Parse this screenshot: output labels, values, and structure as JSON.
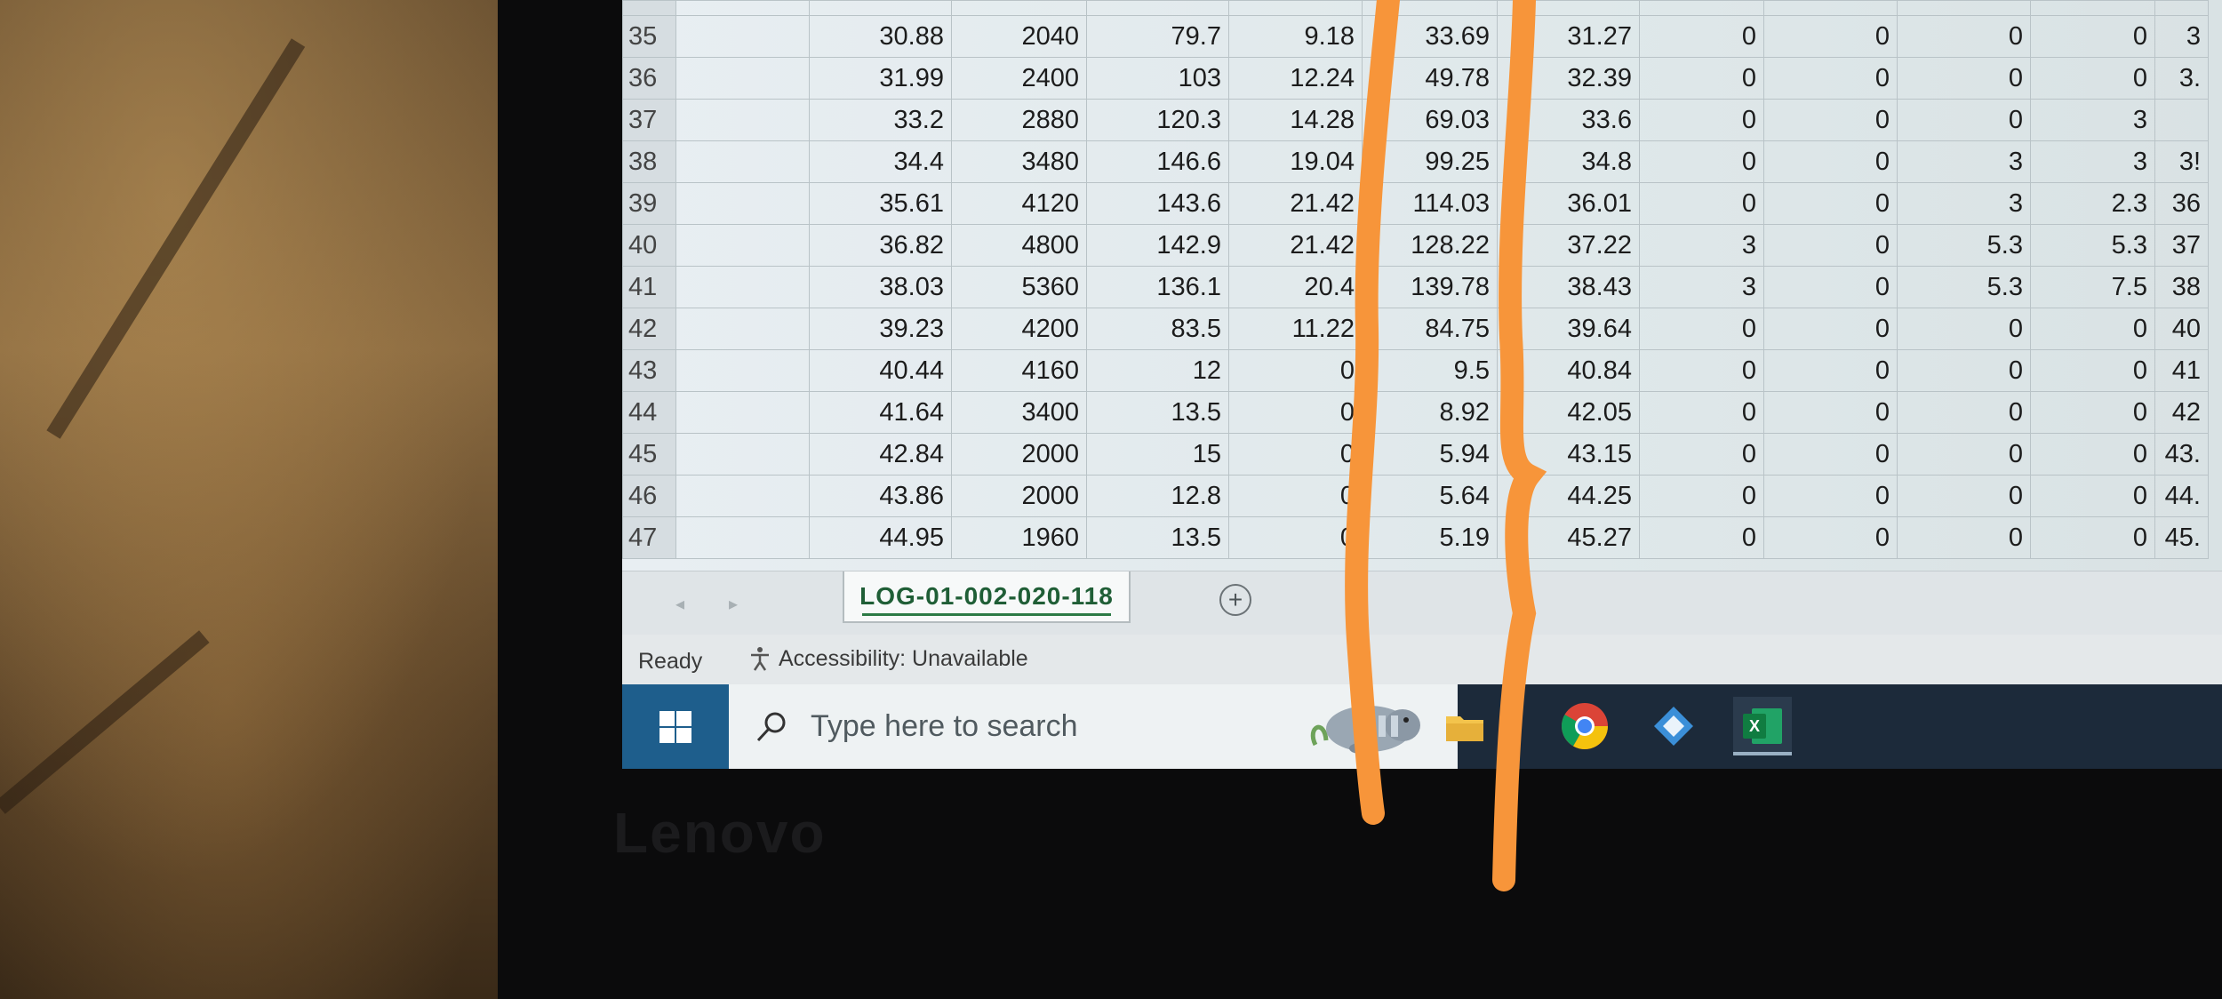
{
  "sheet": {
    "rows": [
      {
        "num": "35",
        "cells": [
          "30.88",
          "2040",
          "79.7",
          "9.18",
          "33.69",
          "31.27",
          "0",
          "0",
          "0",
          "0",
          "3"
        ]
      },
      {
        "num": "36",
        "cells": [
          "31.99",
          "2400",
          "103",
          "12.24",
          "49.78",
          "32.39",
          "0",
          "0",
          "0",
          "0",
          "3."
        ]
      },
      {
        "num": "37",
        "cells": [
          "33.2",
          "2880",
          "120.3",
          "14.28",
          "69.03",
          "33.6",
          "0",
          "0",
          "0",
          "3",
          ""
        ]
      },
      {
        "num": "38",
        "cells": [
          "34.4",
          "3480",
          "146.6",
          "19.04",
          "99.25",
          "34.8",
          "0",
          "0",
          "3",
          "3",
          "3!"
        ]
      },
      {
        "num": "39",
        "cells": [
          "35.61",
          "4120",
          "143.6",
          "21.42",
          "114.03",
          "36.01",
          "0",
          "0",
          "3",
          "2.3",
          "36"
        ]
      },
      {
        "num": "40",
        "cells": [
          "36.82",
          "4800",
          "142.9",
          "21.42",
          "128.22",
          "37.22",
          "3",
          "0",
          "5.3",
          "5.3",
          "37"
        ]
      },
      {
        "num": "41",
        "cells": [
          "38.03",
          "5360",
          "136.1",
          "20.4",
          "139.78",
          "38.43",
          "3",
          "0",
          "5.3",
          "7.5",
          "38"
        ]
      },
      {
        "num": "42",
        "cells": [
          "39.23",
          "4200",
          "83.5",
          "11.22",
          "84.75",
          "39.64",
          "0",
          "0",
          "0",
          "0",
          "40"
        ]
      },
      {
        "num": "43",
        "cells": [
          "40.44",
          "4160",
          "12",
          "0",
          "9.5",
          "40.84",
          "0",
          "0",
          "0",
          "0",
          "41"
        ]
      },
      {
        "num": "44",
        "cells": [
          "41.64",
          "3400",
          "13.5",
          "0",
          "8.92",
          "42.05",
          "0",
          "0",
          "0",
          "0",
          "42"
        ]
      },
      {
        "num": "45",
        "cells": [
          "42.84",
          "2000",
          "15",
          "0",
          "5.94",
          "43.15",
          "0",
          "0",
          "0",
          "0",
          "43."
        ]
      },
      {
        "num": "46",
        "cells": [
          "43.86",
          "2000",
          "12.8",
          "0",
          "5.64",
          "44.25",
          "0",
          "0",
          "0",
          "0",
          "44."
        ]
      },
      {
        "num": "47",
        "cells": [
          "44.95",
          "1960",
          "13.5",
          "0",
          "5.19",
          "45.27",
          "0",
          "0",
          "0",
          "0",
          "45."
        ]
      }
    ]
  },
  "tabs": {
    "active": "LOG-01-002-020-118",
    "add_symbol": "+"
  },
  "status": {
    "ready": "Ready",
    "accessibility": "Accessibility: Unavailable"
  },
  "taskbar": {
    "search_placeholder": "Type here to search",
    "apps": [
      "task-view",
      "file-explorer",
      "chrome",
      "cortana",
      "excel"
    ]
  },
  "laptop_brand": "Lenovo",
  "colors": {
    "excel_green": "#1f7245",
    "marker_orange": "#f7953a",
    "taskbar": "#1c2a3a"
  }
}
